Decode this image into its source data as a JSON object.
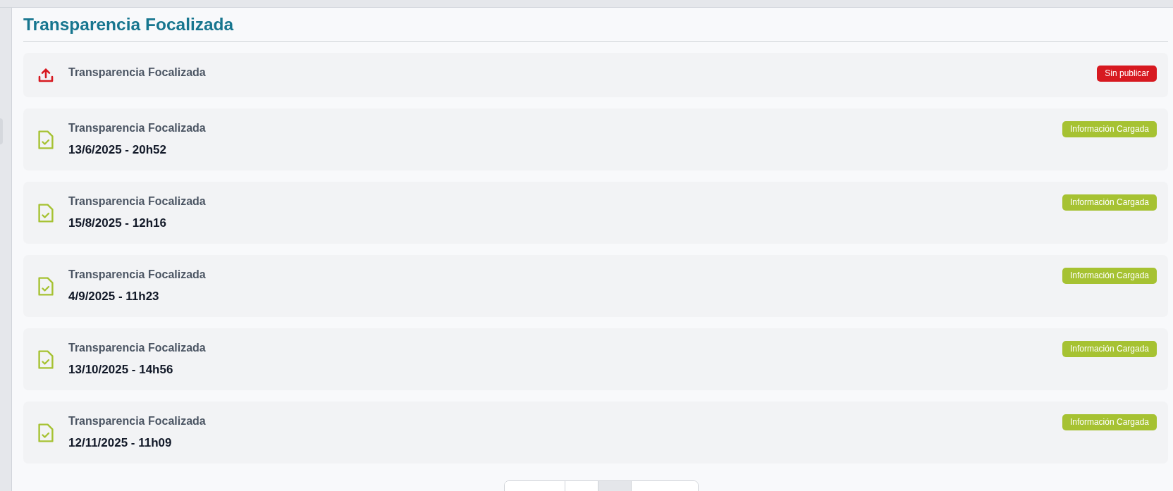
{
  "page": {
    "title": "Transparencia Focalizada"
  },
  "items": [
    {
      "kind": "pending",
      "title": "Transparencia Focalizada",
      "badge": {
        "text": "Sin publicar",
        "color": "#d71920"
      }
    },
    {
      "kind": "loaded",
      "title": "Transparencia Focalizada",
      "date": "13/6/2025 - 20h52",
      "badge": {
        "text": "Información Cargada",
        "color": "#a6c232"
      }
    },
    {
      "kind": "loaded",
      "title": "Transparencia Focalizada",
      "date": "15/8/2025 - 12h16",
      "badge": {
        "text": "Información Cargada",
        "color": "#a6c232"
      }
    },
    {
      "kind": "loaded",
      "title": "Transparencia Focalizada",
      "date": "4/9/2025 - 11h23",
      "badge": {
        "text": "Información Cargada",
        "color": "#a6c232"
      }
    },
    {
      "kind": "loaded",
      "title": "Transparencia Focalizada",
      "date": "13/10/2025 - 14h56",
      "badge": {
        "text": "Información Cargada",
        "color": "#a6c232"
      }
    },
    {
      "kind": "loaded",
      "title": "Transparencia Focalizada",
      "date": "12/11/2025 - 11h09",
      "badge": {
        "text": "Información Cargada",
        "color": "#a6c232"
      }
    }
  ],
  "pagination": [
    {
      "kind": "previous",
      "selected": false
    },
    {
      "kind": "page",
      "selected": false
    },
    {
      "kind": "page",
      "selected": true
    },
    {
      "kind": "next",
      "selected": false
    }
  ]
}
